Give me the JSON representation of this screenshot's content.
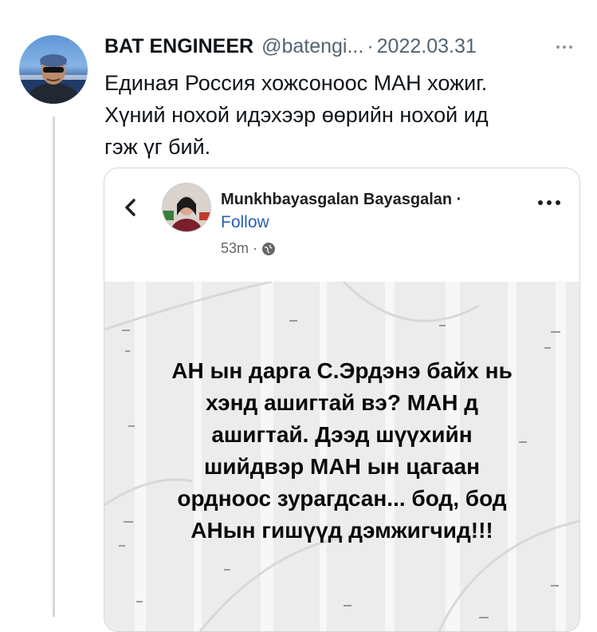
{
  "tweet": {
    "author_name": "BAT ENGINEER",
    "handle": "@batengi...",
    "separator": "·",
    "date": "2022.03.31",
    "text_lines": [
      "Единая Россия хожсоноос МАН хожиг.",
      "Хүний нохой идэхээр өөрийн нохой ид",
      "гэж үг бий."
    ]
  },
  "embedded_post": {
    "author_name": "Munkhbayasgalan Bayasgalan ·",
    "follow_label": "Follow",
    "time": "53m ·",
    "post_text_lines": [
      "АН ын дарга С.Эрдэнэ байх нь",
      "хэнд ашигтай вэ? МАН д",
      "ашигтай. Дээд шүүхийн",
      "шийдвэр МАН ын цагаан",
      "ордноос зурагдсан... бод, бод",
      "АНын гишүүд дэмжигчид!!!"
    ]
  },
  "icons": {
    "more": "more-horizontal-icon",
    "back": "chevron-left-icon",
    "globe": "globe-icon"
  },
  "colors": {
    "secondary_text": "#536471",
    "link_blue": "#2a5fb4",
    "border": "#cfd9de"
  }
}
